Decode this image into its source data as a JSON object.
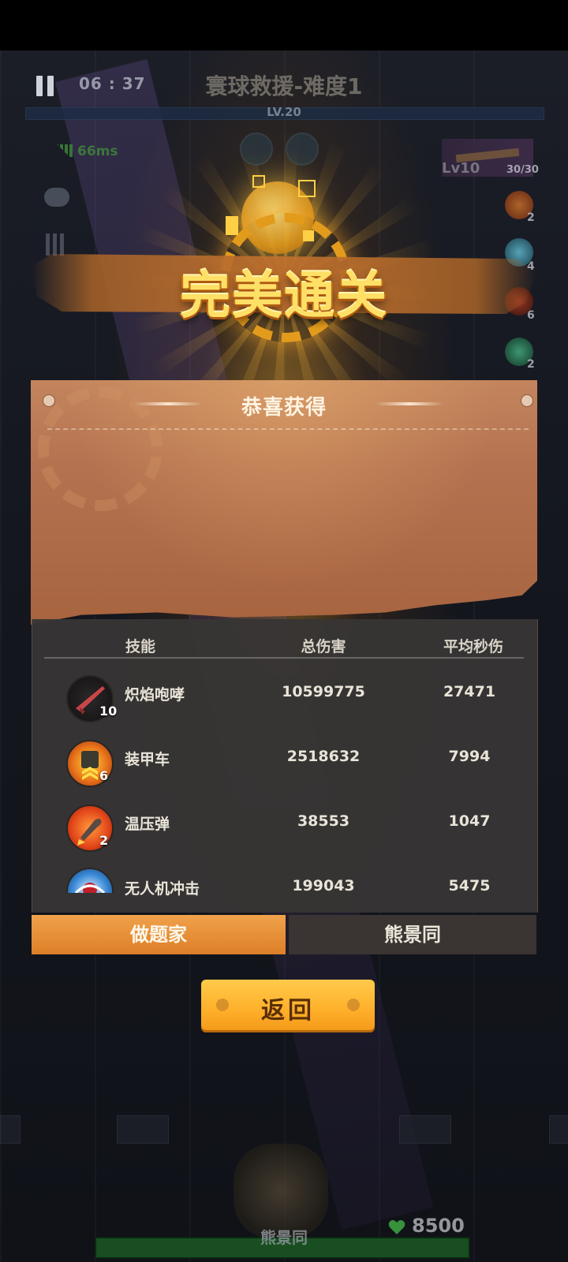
{
  "hud": {
    "timer": "06 : 37",
    "stage_title": "寰球救援-难度1",
    "level": "LV.20",
    "ping": "66ms",
    "weapon_level": "Lv10",
    "weapon_ammo": "30/30",
    "side_skills": [
      {
        "icon": "flame-bullet-icon",
        "count": "2"
      },
      {
        "icon": "drone-icon",
        "count": "4"
      },
      {
        "icon": "mine-icon",
        "count": "6"
      },
      {
        "icon": "tornado-icon",
        "count": "2"
      }
    ],
    "player_name": "熊景同",
    "hp": "8500"
  },
  "banner": {
    "title": "完美通关"
  },
  "reward_panel": {
    "title": "恭喜获得",
    "columns": [
      "技能",
      "总伤害",
      "平均秒伤"
    ],
    "rows": [
      {
        "icon": "flame-rifle-icon",
        "level": "10",
        "name": "炽焰咆哮",
        "total": "10599775",
        "dps": "27471"
      },
      {
        "icon": "armored-car-icon",
        "level": "6",
        "name": "装甲车",
        "total": "2518632",
        "dps": "7994"
      },
      {
        "icon": "thermobaric-shell-icon",
        "level": "2",
        "name": "温压弹",
        "total": "38553",
        "dps": "1047"
      },
      {
        "icon": "drone-strike-icon",
        "level": "",
        "name": "无人机冲击",
        "total": "199043",
        "dps": "5475"
      }
    ]
  },
  "tabs": [
    {
      "label": "做题家",
      "active": true
    },
    {
      "label": "熊景同",
      "active": false
    }
  ],
  "back_button": {
    "label": "返回"
  },
  "colors": {
    "accent": "#ffb02b",
    "panel_brown": "#b57250",
    "tab_active": "#e6902f",
    "table_bg": "#373534"
  }
}
